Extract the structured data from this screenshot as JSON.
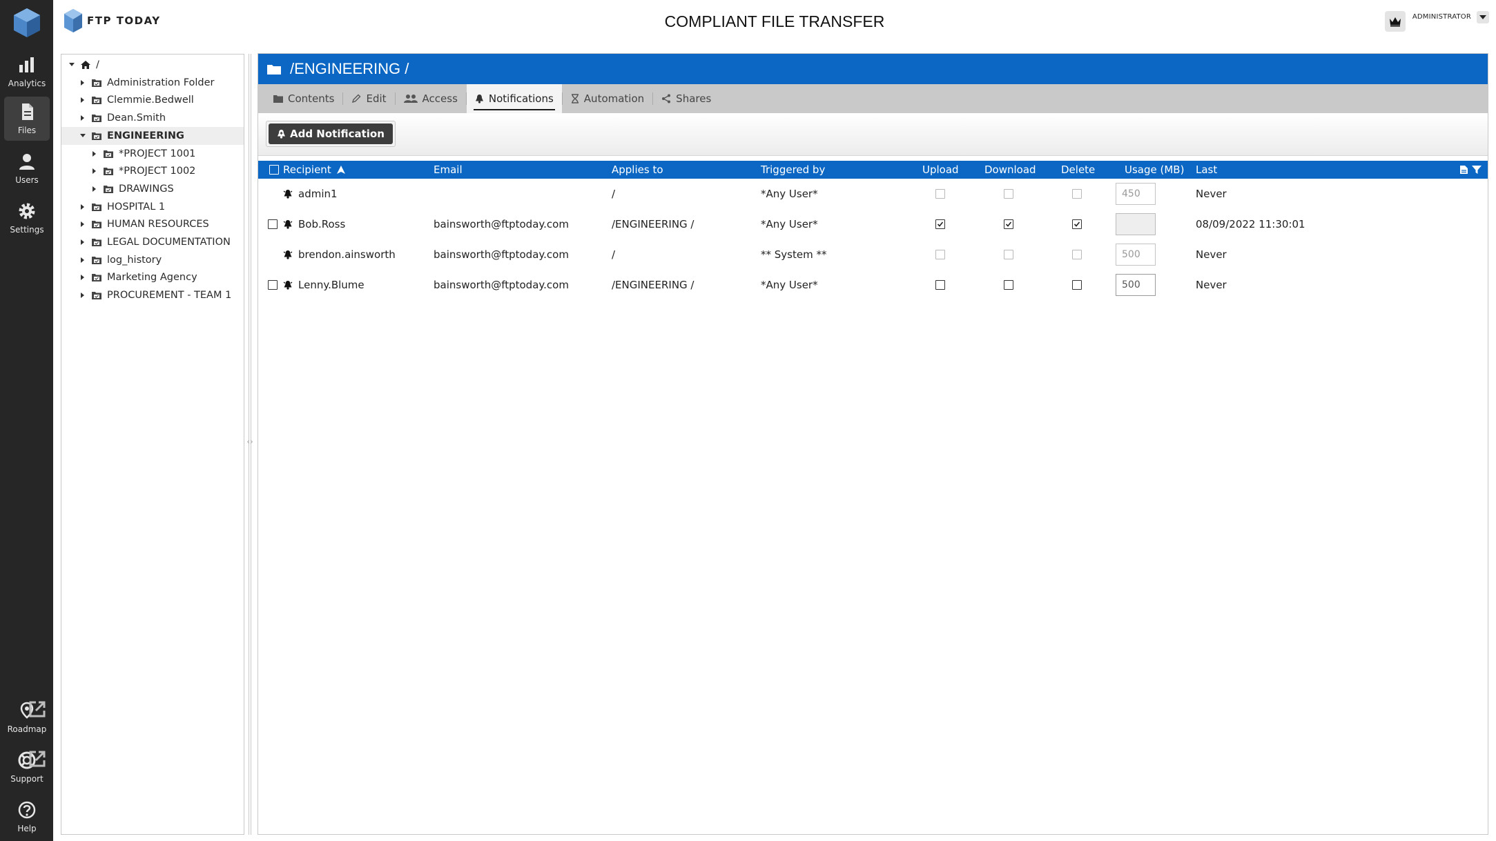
{
  "app": {
    "brand": "FTP TODAY",
    "title": "COMPLIANT FILE TRANSFER",
    "user_role": "ADMINISTRATOR"
  },
  "nav": {
    "items": [
      {
        "label": "Analytics",
        "icon": "bar-chart-icon"
      },
      {
        "label": "Files",
        "icon": "file-icon",
        "active": true
      },
      {
        "label": "Users",
        "icon": "user-icon"
      },
      {
        "label": "Settings",
        "icon": "gear-icon"
      }
    ],
    "bottom": [
      {
        "label": "Roadmap",
        "icon": "map-pin-icon"
      },
      {
        "label": "Support",
        "icon": "lifebuoy-icon"
      },
      {
        "label": "Help",
        "icon": "question-icon"
      }
    ]
  },
  "tree": {
    "root": "/",
    "items": [
      {
        "label": "Administration Folder"
      },
      {
        "label": "Clemmie.Bedwell"
      },
      {
        "label": "Dean.Smith"
      },
      {
        "label": "ENGINEERING",
        "selected": true,
        "expanded": true
      },
      {
        "label": "*PROJECT 1001"
      },
      {
        "label": "*PROJECT 1002"
      },
      {
        "label": "DRAWINGS"
      },
      {
        "label": "HOSPITAL 1"
      },
      {
        "label": "HUMAN RESOURCES"
      },
      {
        "label": "LEGAL DOCUMENTATION"
      },
      {
        "label": "log_history"
      },
      {
        "label": "Marketing Agency"
      },
      {
        "label": "PROCUREMENT - TEAM 1"
      }
    ]
  },
  "folder": {
    "path": "/ENGINEERING /"
  },
  "tabs": [
    {
      "label": "Contents",
      "icon": "folder-icon"
    },
    {
      "label": "Edit",
      "icon": "pencil-icon"
    },
    {
      "label": "Access",
      "icon": "users-icon"
    },
    {
      "label": "Notifications",
      "icon": "bell-icon",
      "active": true
    },
    {
      "label": "Automation",
      "icon": "hourglass-icon"
    },
    {
      "label": "Shares",
      "icon": "share-icon"
    }
  ],
  "toolbar": {
    "add_label": "Add Notification"
  },
  "table": {
    "columns": [
      "Recipient",
      "Email",
      "Applies to",
      "Triggered by",
      "Upload",
      "Download",
      "Delete",
      "Usage (MB)",
      "Last"
    ],
    "rows": [
      {
        "recipient": "admin1",
        "email": "",
        "applies_to": "/",
        "triggered_by": "*Any User*",
        "upload": false,
        "download": false,
        "delete": false,
        "usage": "450",
        "last": "Never",
        "selectable": false,
        "enabled": false
      },
      {
        "recipient": "Bob.Ross",
        "email": "bainsworth@ftptoday.com",
        "applies_to": "/ENGINEERING /",
        "triggered_by": "*Any User*",
        "upload": true,
        "download": true,
        "delete": true,
        "usage": "",
        "last": "08/09/2022 11:30:01",
        "selectable": true,
        "enabled": true
      },
      {
        "recipient": "brendon.ainsworth",
        "email": "bainsworth@ftptoday.com",
        "applies_to": "/",
        "triggered_by": "** System **",
        "upload": false,
        "download": false,
        "delete": false,
        "usage": "500",
        "last": "Never",
        "selectable": false,
        "enabled": false
      },
      {
        "recipient": "Lenny.Blume",
        "email": "bainsworth@ftptoday.com",
        "applies_to": "/ENGINEERING /",
        "triggered_by": "*Any User*",
        "upload": false,
        "download": false,
        "delete": false,
        "usage": "500",
        "last": "Never",
        "selectable": true,
        "enabled": true
      }
    ]
  },
  "colors": {
    "accent": "#0b67c3",
    "nav_bg": "#262626"
  }
}
